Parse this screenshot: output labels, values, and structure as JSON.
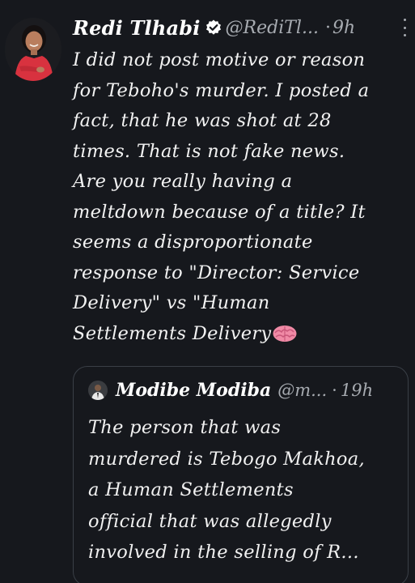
{
  "tweet": {
    "author_name": "Redi Tlhabi",
    "handle": "@RediTl...",
    "separator": "·",
    "time": "9h",
    "lines": [
      "I did not post motive or reason",
      "for Teboho's murder. I posted a",
      "fact, that he was shot at 28",
      "times. That is not fake news.",
      "Are you really having a",
      "meltdown because of a title? It",
      "seems a disproportionate",
      "response to \"Director: Service",
      "Delivery\" vs \"Human",
      "Settlements Delivery"
    ],
    "icons": {
      "verified": "verified-badge-icon",
      "more": "more-options-icon",
      "emoji": "brain-emoji-icon"
    },
    "colors": {
      "background": "#16181d",
      "text": "#f2f2f2",
      "muted": "#a7abb1",
      "border": "#3a3f47",
      "avatar_outfit": "#d8323f",
      "brain": "#f08aa6"
    }
  },
  "quote": {
    "author_name": "Modibe Modiba",
    "handle": "@m...",
    "separator": "·",
    "time": "19h",
    "lines": [
      "The person that was",
      "murdered is Tebogo Makhoa,",
      "a Human Settlements",
      "official that was allegedly",
      "involved in the selling of R..."
    ]
  }
}
